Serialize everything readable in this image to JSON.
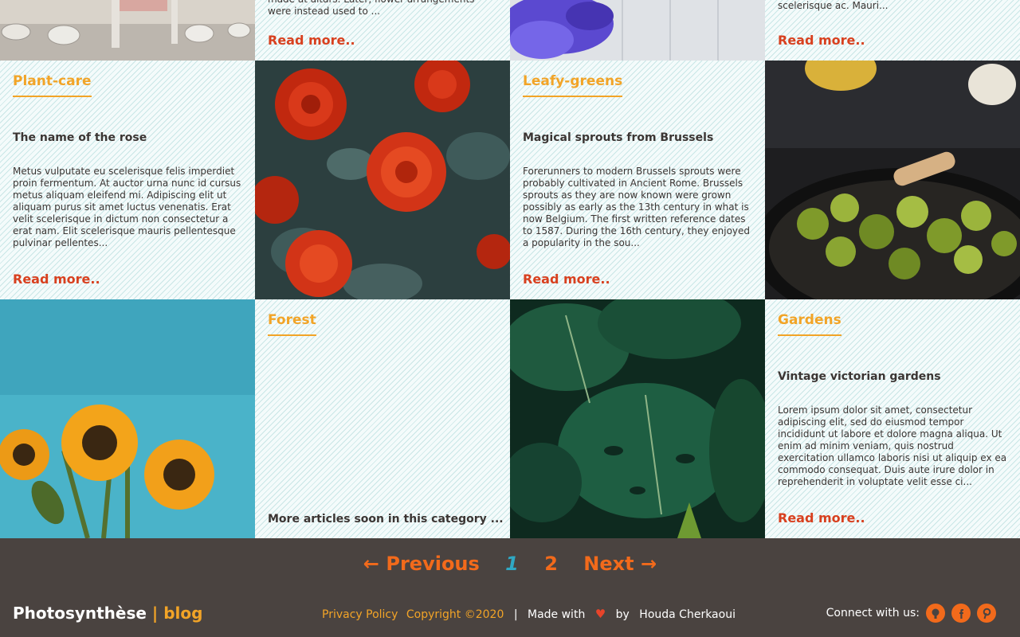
{
  "row0": {
    "card2": {
      "excerpt_tail": "made at altars. Later, flower arrangements were instead used to ...",
      "read_more": "Read more.."
    },
    "card4": {
      "excerpt_tail": "scelerisque ac. Mauri...",
      "read_more": "Read more.."
    }
  },
  "row1": {
    "card1": {
      "category": "Plant-care",
      "title": "The name of the rose",
      "excerpt": "Metus vulputate eu scelerisque felis imperdiet proin fermentum. At auctor urna nunc id cursus metus aliquam eleifend mi. Adipiscing elit ut aliquam purus sit amet luctus venenatis. Erat velit scelerisque in dictum non consectetur a erat nam. Elit scelerisque mauris pellentesque pulvinar pellentes...",
      "read_more": "Read more.."
    },
    "card3": {
      "category": "Leafy-greens",
      "title": "Magical sprouts from Brussels",
      "excerpt": "Forerunners to modern Brussels sprouts were probably cultivated in Ancient Rome. Brussels sprouts as they are now known were grown possibly as early as the 13th century in what is now Belgium. The first written reference dates to 1587. During the 16th century, they enjoyed a popularity in the sou...",
      "read_more": "Read more.."
    }
  },
  "row2": {
    "card2": {
      "category": "Forest",
      "empty_note": "More articles soon in this category ..."
    },
    "card4": {
      "category": "Gardens",
      "title": "Vintage victorian gardens",
      "excerpt": "Lorem ipsum dolor sit amet, consectetur adipiscing elit, sed do eiusmod tempor incididunt ut labore et dolore magna aliqua. Ut enim ad minim veniam, quis nostrud exercitation ullamco laboris nisi ut aliquip ex ea commodo consequat. Duis aute irure dolor in reprehenderit in voluptate velit esse ci...",
      "read_more": "Read more.."
    }
  },
  "pagination": {
    "previous": "← Previous",
    "page1": "1",
    "page2": "2",
    "next": "Next →"
  },
  "footer": {
    "brand_name": "Photosynthèse",
    "brand_sep": "|",
    "brand_suffix": "blog",
    "privacy": "Privacy Policy",
    "copyright": "Copyright ©2020",
    "divider": "|",
    "made_with": "Made with",
    "by": "by",
    "author": "Houda Cherkaoui",
    "connect": "Connect with us:"
  },
  "colors": {
    "accent_orange": "#f2a427",
    "read_more_red": "#d8401f",
    "footer_bg": "#4a4340",
    "active_page": "#2fa8c4"
  },
  "icons": [
    "github-icon",
    "facebook-icon",
    "pinterest-icon",
    "heart-icon"
  ]
}
